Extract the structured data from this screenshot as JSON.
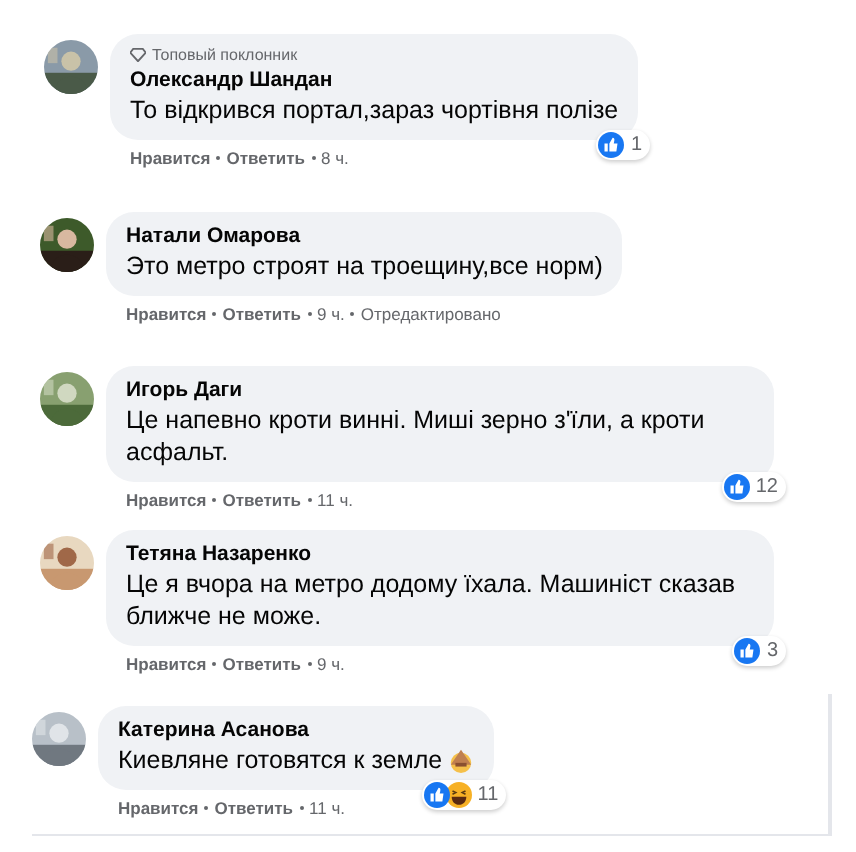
{
  "comments": [
    {
      "badge": "Топовый поклонник",
      "author": "Олександр Шандан",
      "text": "То відкрився портал,зараз чортівня полізе",
      "reactions": [
        {
          "kind": "like"
        }
      ],
      "reaction_count": "1",
      "like": "Нравится",
      "reply": "Ответить",
      "time": "8 ч."
    },
    {
      "author": "Натали Омарова",
      "text": "Это метро строят на троещину,все норм)",
      "like": "Нравится",
      "reply": "Ответить",
      "time": "9 ч.",
      "edited": "Отредактировано"
    },
    {
      "author": "Игорь Даги",
      "text": "Це напевно кроти винні. Миші зерно з'їли, а кроти асфальт.",
      "reactions": [
        {
          "kind": "like"
        }
      ],
      "reaction_count": "12",
      "like": "Нравится",
      "reply": "Ответить",
      "time": "11 ч."
    },
    {
      "author": "Тетяна Назаренко",
      "text": "Це я вчора на метро додому їхала. Машиніст сказав ближче не може.",
      "reactions": [
        {
          "kind": "like"
        }
      ],
      "reaction_count": "3",
      "like": "Нравится",
      "reply": "Ответить",
      "time": "9 ч."
    },
    {
      "author": "Катерина Асанова",
      "text": "Киевляне готовятся к земле",
      "emoji": true,
      "reactions": [
        {
          "kind": "like"
        },
        {
          "kind": "haha"
        }
      ],
      "reaction_count": "11",
      "like": "Нравится",
      "reply": "Ответить",
      "time": "11 ч."
    }
  ]
}
